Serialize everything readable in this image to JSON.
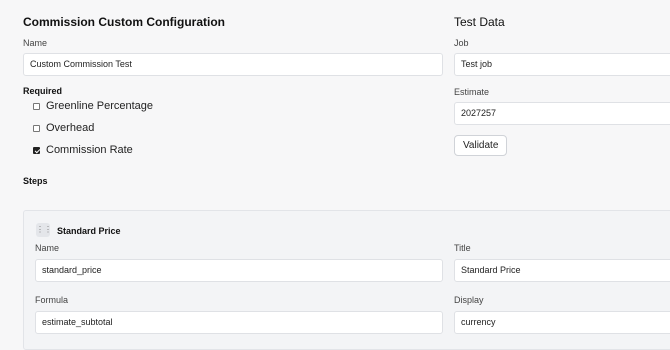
{
  "config": {
    "title": "Commission Custom Configuration",
    "name_label": "Name",
    "name_value": "Custom Commission Test",
    "required_label": "Required",
    "options": [
      {
        "label": "Greenline Percentage",
        "checked": false
      },
      {
        "label": "Overhead",
        "checked": false
      },
      {
        "label": "Commission Rate",
        "checked": true
      }
    ]
  },
  "test_data": {
    "title": "Test Data",
    "job_label": "Job",
    "job_value": "Test job",
    "estimate_label": "Estimate",
    "estimate_value": "2027257",
    "validate_label": "Validate"
  },
  "steps": {
    "title": "Steps",
    "items": [
      {
        "heading": "Standard Price",
        "drag_icon": "drag-handle-icon",
        "name_label": "Name",
        "name_value": "standard_price",
        "title_label": "Title",
        "title_value": "Standard Price",
        "formula_label": "Formula",
        "formula_value": "estimate_subtotal",
        "display_label": "Display",
        "display_value": "currency"
      }
    ]
  }
}
